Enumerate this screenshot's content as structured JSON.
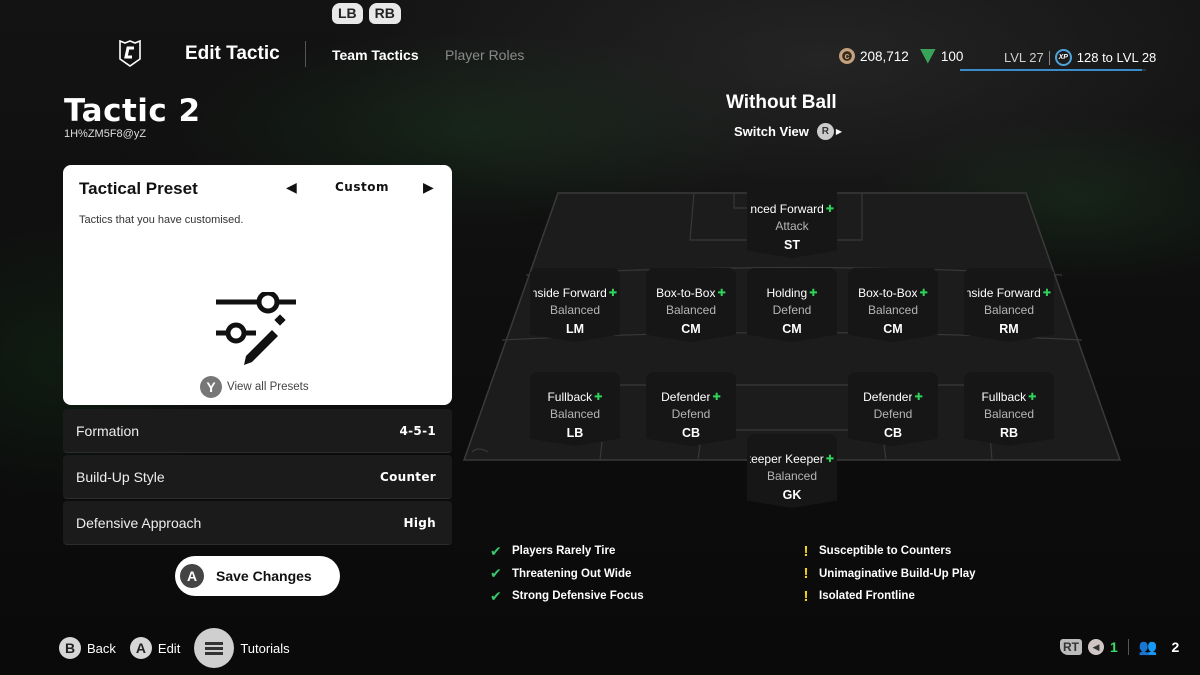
{
  "bumpers": {
    "left": "LB",
    "right": "RB"
  },
  "header": {
    "title": "Edit Tactic",
    "tabs": [
      {
        "label": "Team Tactics",
        "active": true
      },
      {
        "label": "Player Roles",
        "active": false
      }
    ]
  },
  "currency": {
    "coins": "208,712",
    "points": "100"
  },
  "level": {
    "current": "LVL 27",
    "xp_badge": "XP",
    "to_next": "128 to LVL 28",
    "progress_fraction": 0.98
  },
  "tactic": {
    "name": "Tactic 2",
    "code": "1H%ZM5F8@yZ"
  },
  "preset": {
    "title": "Tactical Preset",
    "value": "Custom",
    "description": "Tactics that you have customised.",
    "view_all_glyph": "Y",
    "view_all_label": "View all Presets",
    "icon": "sliders-pencil-icon"
  },
  "settings": [
    {
      "label": "Formation",
      "value": "4-5-1"
    },
    {
      "label": "Build-Up Style",
      "value": "Counter"
    },
    {
      "label": "Defensive Approach",
      "value": "High"
    }
  ],
  "save_button": {
    "glyph": "A",
    "label": "Save Changes"
  },
  "view": {
    "title": "Without Ball",
    "switch_label": "Switch View",
    "switch_glyph": "R"
  },
  "players": [
    {
      "role": "Advanced Forward",
      "focus": "Attack",
      "pos": "ST"
    },
    {
      "role": "Inside Forward",
      "focus": "Balanced",
      "pos": "LM"
    },
    {
      "role": "Box-to-Box",
      "focus": "Balanced",
      "pos": "CM"
    },
    {
      "role": "Holding",
      "focus": "Defend",
      "pos": "CM"
    },
    {
      "role": "Box-to-Box",
      "focus": "Balanced",
      "pos": "CM"
    },
    {
      "role": "Inside Forward",
      "focus": "Balanced",
      "pos": "RM"
    },
    {
      "role": "Fullback",
      "focus": "Balanced",
      "pos": "LB"
    },
    {
      "role": "Defender",
      "focus": "Defend",
      "pos": "CB"
    },
    {
      "role": "Defender",
      "focus": "Defend",
      "pos": "CB"
    },
    {
      "role": "Fullback",
      "focus": "Balanced",
      "pos": "RB"
    },
    {
      "role": "Goalkeeper Keeper",
      "focus": "Balanced",
      "pos": "GK"
    }
  ],
  "strengths": [
    "Players Rarely Tire",
    "Threatening Out Wide",
    "Strong Defensive Focus"
  ],
  "weaknesses": [
    "Susceptible to Counters",
    "Unimaginative Build-Up Play",
    "Isolated Frontline"
  ],
  "footer": {
    "back_glyph": "B",
    "back_label": "Back",
    "edit_glyph": "A",
    "edit_label": "Edit",
    "tutorials_label": "Tutorials"
  },
  "bottom_right": {
    "rt_glyph": "RT",
    "voice_count": "1",
    "party_count": "2"
  },
  "colors": {
    "accent_green": "#3ddc6a",
    "warning_yellow": "#f2d21c",
    "xp_blue": "#3a8bc9"
  }
}
